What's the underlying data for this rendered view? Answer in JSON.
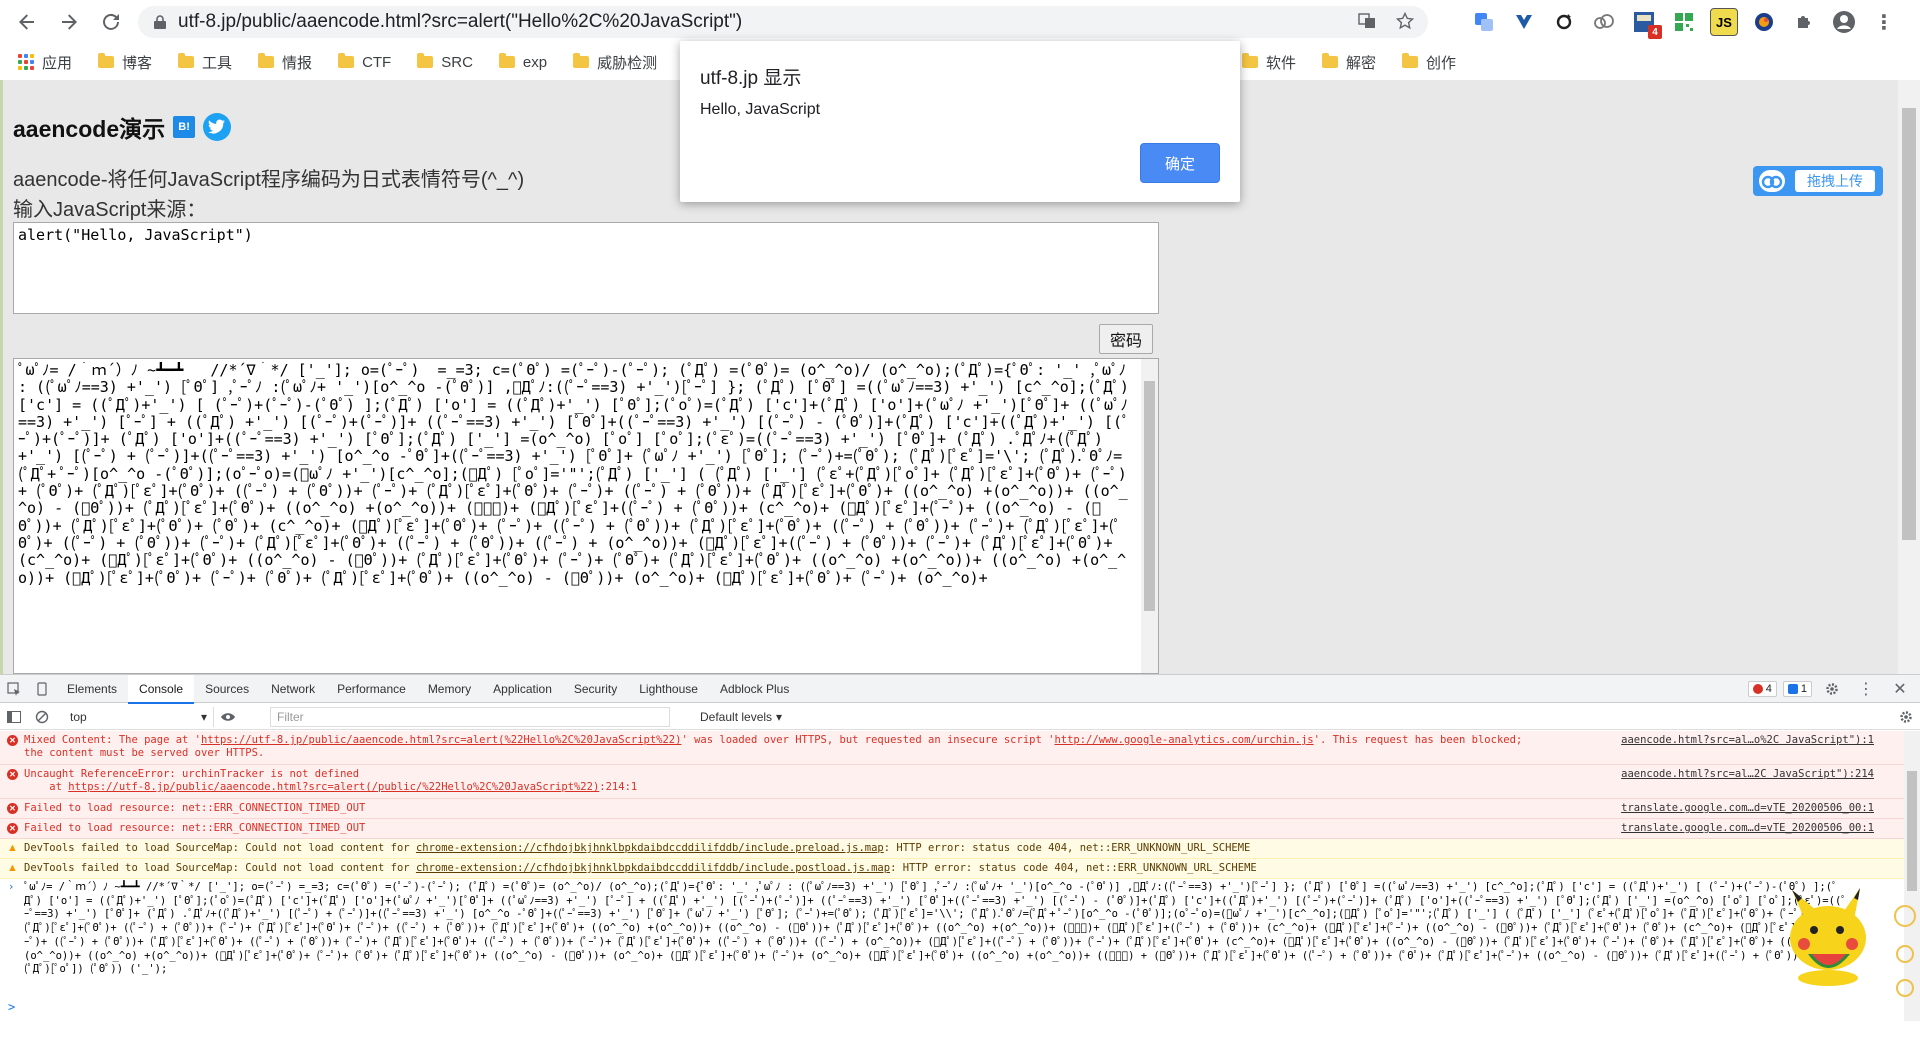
{
  "browser": {
    "url": "utf-8.jp/public/aaencode.html?src=alert(\"Hello%2C%20JavaScript\")",
    "bookmarks": [
      "应用",
      "博客",
      "工具",
      "情报",
      "CTF",
      "SRC",
      "exp",
      "威胁检测",
      "软件",
      "解密",
      "创作"
    ],
    "ext_badge": "4"
  },
  "page": {
    "title": "aaencode演示",
    "hatena_label": "B!",
    "description": "aaencode-将任何JavaScript程序编码为日式表情符号(^_^)",
    "input_label": "输入JavaScript来源：",
    "source_value": "alert(\"Hello, JavaScript\")",
    "encode_button": "密码",
    "upload_button": "拖拽上传",
    "output_text": "ﾟωﾟﾉ= /｀ｍ´）ﾉ ~┻━┻   //*´∇｀*/ ['_']; o=(ﾟｰﾟ)  =_=3; c=(ﾟΘﾟ) =(ﾟｰﾟ)-(ﾟｰﾟ); (ﾟДﾟ) =(ﾟΘﾟ)= (o^_^o)/ (o^_^o);(ﾟДﾟ)={ﾟΘﾟ: '_' ,ﾟωﾟﾉ : ((ﾟωﾟﾉ==3) +'_') [ﾟΘﾟ] ,ﾟｰﾟﾉ :(ﾟωﾟﾉ+ '_')[o^_^o -(ﾟΘﾟ)] ,ﾟДﾟﾉ:((ﾟｰﾟ==3) +'_')[ﾟｰﾟ] }; (ﾟДﾟ) [ﾟΘﾟ] =((ﾟωﾟﾉ==3) +'_') [c^_^o];(ﾟДﾟ) ['c'] = ((ﾟДﾟ)+'_') [ (ﾟｰﾟ)+(ﾟｰﾟ)-(ﾟΘﾟ) ];(ﾟДﾟ) ['o'] = ((ﾟДﾟ)+'_') [ﾟΘﾟ];(ﾟoﾟ)=(ﾟДﾟ) ['c']+(ﾟДﾟ) ['o']+(ﾟωﾟﾉ +'_')[ﾟΘﾟ]+ ((ﾟωﾟﾉ==3) +'_') [ﾟｰﾟ] + ((ﾟДﾟ) +'_') [(ﾟｰﾟ)+(ﾟｰﾟ)]+ ((ﾟｰﾟ==3) +'_') [ﾟΘﾟ]+((ﾟｰﾟ==3) +'_') [(ﾟｰﾟ) - (ﾟΘﾟ)]+(ﾟДﾟ) ['c']+((ﾟДﾟ)+'_') [(ﾟｰﾟ)+(ﾟｰﾟ)]+ (ﾟДﾟ) ['o']+((ﾟｰﾟ==3) +'_') [ﾟΘﾟ];(ﾟДﾟ) ['_'] =(o^_^o) [ﾟoﾟ] [ﾟoﾟ];(ﾟεﾟ)=((ﾟｰﾟ==3) +'_') [ﾟΘﾟ]+ (ﾟДﾟ) .ﾟДﾟﾉ+((ﾟДﾟ)+'_') [(ﾟｰﾟ) + (ﾟｰﾟ)]+((ﾟｰﾟ==3) +'_') [o^_^o -ﾟΘﾟ]+((ﾟｰﾟ==3) +'_') [ﾟΘﾟ]+ (ﾟωﾟﾉ +'_') [ﾟΘﾟ]; (ﾟｰﾟ)+=(ﾟΘﾟ); (ﾟДﾟ)[ﾟεﾟ]='\\'; (ﾟДﾟ).ﾟΘﾟﾉ=(ﾟДﾟ+ ﾟｰﾟ)[o^_^o -(ﾟΘﾟ)];(oﾟｰﾟo)=(ﾟωﾟﾉ +'_')[c^_^o];(ﾟДﾟ) [ﾟoﾟ]='\"';(ﾟДﾟ) ['_'] ( (ﾟДﾟ) ['_'] (ﾟεﾟ+(ﾟДﾟ)[ﾟoﾟ]+ (ﾟДﾟ)[ﾟεﾟ]+(ﾟΘﾟ)+ (ﾟｰﾟ)+ (ﾟΘﾟ)+ (ﾟДﾟ)[ﾟεﾟ]+(ﾟΘﾟ)+ ((ﾟｰﾟ) + (ﾟΘﾟ))+ (ﾟｰﾟ)+ (ﾟДﾟ)[ﾟεﾟ]+(ﾟΘﾟ)+ (ﾟｰﾟ)+ ((ﾟｰﾟ) + (ﾟΘﾟ))+ (ﾟДﾟ)[ﾟεﾟ]+(ﾟΘﾟ)+ ((o^_^o) +(o^_^o))+ ((o^_^o) - (ﾟΘﾟ))+ (ﾟДﾟ)[ﾟεﾟ]+(ﾟΘﾟ)+ ((o^_^o) +(o^_^o))+ (ﾟｰﾟ)+ (ﾟДﾟ)[ﾟεﾟ]+((ﾟｰﾟ) + (ﾟΘﾟ))+ (c^_^o)+ (ﾟДﾟ)[ﾟεﾟ]+(ﾟｰﾟ)+ ((o^_^o) - (ﾟΘﾟ))+ (ﾟДﾟ)[ﾟεﾟ]+(ﾟΘﾟ)+ (ﾟΘﾟ)+ (c^_^o)+ (ﾟДﾟ)[ﾟεﾟ]+(ﾟΘﾟ)+ (ﾟｰﾟ)+ ((ﾟｰﾟ) + (ﾟΘﾟ))+ (ﾟДﾟ)[ﾟεﾟ]+(ﾟΘﾟ)+ ((ﾟｰﾟ) + (ﾟΘﾟ))+ (ﾟｰﾟ)+ (ﾟДﾟ)[ﾟεﾟ]+(ﾟΘﾟ)+ ((ﾟｰﾟ) + (ﾟΘﾟ))+ (ﾟｰﾟ)+ (ﾟДﾟ)[ﾟεﾟ]+(ﾟΘﾟ)+ ((ﾟｰﾟ) + (ﾟΘﾟ))+ ((ﾟｰﾟ) + (o^_^o))+ (ﾟДﾟ)[ﾟεﾟ]+((ﾟｰﾟ) + (ﾟΘﾟ))+ (ﾟｰﾟ)+ (ﾟДﾟ)[ﾟεﾟ]+(ﾟΘﾟ)+ (c^_^o)+ (ﾟДﾟ)[ﾟεﾟ]+(ﾟΘﾟ)+ ((o^_^o) - (ﾟΘﾟ))+ (ﾟДﾟ)[ﾟεﾟ]+(ﾟΘﾟ)+ (ﾟｰﾟ)+ (ﾟΘﾟ)+ (ﾟДﾟ)[ﾟεﾟ]+(ﾟΘﾟ)+ ((o^_^o) +(o^_^o))+ ((o^_^o) +(o^_^o))+ (ﾟДﾟ)[ﾟεﾟ]+(ﾟΘﾟ)+ (ﾟｰﾟ)+ (ﾟΘﾟ)+ (ﾟДﾟ)[ﾟεﾟ]+(ﾟΘﾟ)+ ((o^_^o) - (ﾟΘﾟ))+ (o^_^o)+ (ﾟДﾟ)[ﾟεﾟ]+(ﾟΘﾟ)+ (ﾟｰﾟ)+ (o^_^o)+"
  },
  "dialog": {
    "title": "utf-8.jp 显示",
    "message": "Hello, JavaScript",
    "ok_button": "确定"
  },
  "devtools": {
    "tabs": [
      "Elements",
      "Console",
      "Sources",
      "Network",
      "Performance",
      "Memory",
      "Application",
      "Security",
      "Lighthouse",
      "Adblock Plus"
    ],
    "active_tab": "Console",
    "error_count": "4",
    "info_count": "1",
    "context": "top",
    "filter_placeholder": "Filter",
    "levels": "Default levels",
    "messages": [
      {
        "type": "error",
        "text_a": "Mixed Content: The page at '",
        "link_a": "https://utf-8.jp/public/aaencode.html?src=alert(%22Hello%2C%20JavaScript%22)",
        "text_b": "' was loaded over HTTPS, but requested an insecure script '",
        "link_b": "http://www.google-analytics.com/urchin.js",
        "text_c": "'. This request has been blocked;",
        "line2": "the content must be served over HTTPS.",
        "source": "aaencode.html?src=al…o%2C JavaScript\"):1"
      },
      {
        "type": "error",
        "text_a": "Uncaught ReferenceError: urchinTracker is not defined",
        "line2_pre": "    at ",
        "line2_link": "https://utf-8.jp/public/aaencode.html?src=alert(/public/%22Hello%2C%20JavaScript%22)",
        "line2_post": ":214:1",
        "source": "aaencode.html?src=al…2C JavaScript\"):214"
      },
      {
        "type": "error",
        "text_a": "Failed to load resource: net::ERR_CONNECTION_TIMED_OUT",
        "source": "translate.google.com…d=vTE_20200506_00:1"
      },
      {
        "type": "error",
        "text_a": "Failed to load resource: net::ERR_CONNECTION_TIMED_OUT",
        "source": "translate.google.com…d=vTE_20200506_00:1"
      },
      {
        "type": "warn",
        "text_a": "DevTools failed to load SourceMap: Could not load content for ",
        "link_a": "chrome-extension://cfhdojbkjhnklbpkdaibdccddilifddb/include.preload.js.map",
        "text_b": ": HTTP error: status code 404, net::ERR_UNKNOWN_URL_SCHEME"
      },
      {
        "type": "warn",
        "text_a": "DevTools failed to load SourceMap: Could not load content for ",
        "link_a": "chrome-extension://cfhdojbkjhnklbpkdaibdccddilifddb/include.postload.js.map",
        "text_b": ": HTTP error: status code 404, net::ERR_UNKNOWN_URL_SCHEME"
      }
    ],
    "command_echo": "ﾟωﾟﾉ= /｀ｍ´）ﾉ ~┻━┻   //*´∇｀*/ ['_']; o=(ﾟｰﾟ)  =_=3; c=(ﾟΘﾟ) =(ﾟｰﾟ)-(ﾟｰﾟ); (ﾟДﾟ) =(ﾟΘﾟ)= (o^_^o)/ (o^_^o);(ﾟДﾟ)={ﾟΘﾟ: '_' ,ﾟωﾟﾉ : ((ﾟωﾟﾉ==3) +'_') [ﾟΘﾟ] ,ﾟｰﾟﾉ :(ﾟωﾟﾉ+ '_')[o^_^o -(ﾟΘﾟ)] ,ﾟДﾟﾉ:((ﾟｰﾟ==3) +'_')[ﾟｰﾟ] }; (ﾟДﾟ) [ﾟΘﾟ] =((ﾟωﾟﾉ==3) +'_') [c^_^o];(ﾟДﾟ) ['c'] = ((ﾟДﾟ)+'_') [ (ﾟｰﾟ)+(ﾟｰﾟ)-(ﾟΘﾟ) ];(ﾟДﾟ) ['o'] = ((ﾟДﾟ)+'_') [ﾟΘﾟ];(ﾟoﾟ)=(ﾟДﾟ) ['c']+(ﾟДﾟ) ['o']+(ﾟωﾟﾉ +'_')[ﾟΘﾟ]+ ((ﾟωﾟﾉ==3) +'_') [ﾟｰﾟ] + ((ﾟДﾟ) +'_') [(ﾟｰﾟ)+(ﾟｰﾟ)]+ ((ﾟｰﾟ==3) +'_') [ﾟΘﾟ]+((ﾟｰﾟ==3) +'_') [(ﾟｰﾟ) - (ﾟΘﾟ)]+(ﾟДﾟ) ['c']+((ﾟДﾟ)+'_') [(ﾟｰﾟ)+(ﾟｰﾟ)]+ (ﾟДﾟ) ['o']+((ﾟｰﾟ==3) +'_') [ﾟΘﾟ];(ﾟДﾟ) ['_'] =(o^_^o) [ﾟoﾟ] [ﾟoﾟ];(ﾟεﾟ)=((ﾟｰﾟ==3) +'_') [ﾟΘﾟ]+ (ﾟДﾟ) .ﾟДﾟﾉ+((ﾟДﾟ)+'_') [(ﾟｰﾟ) + (ﾟｰﾟ)]+((ﾟｰﾟ==3) +'_') [o^_^o -ﾟΘﾟ]+((ﾟｰﾟ==3) +'_') [ﾟΘﾟ]+ (ﾟωﾟﾉ +'_') [ﾟΘﾟ]; (ﾟｰﾟ)+=(ﾟΘﾟ); (ﾟДﾟ)[ﾟεﾟ]='\\\\'; (ﾟДﾟ).ﾟΘﾟﾉ=(ﾟДﾟ+ ﾟｰﾟ)[o^_^o -(ﾟΘﾟ)];(oﾟｰﾟo)=(ﾟωﾟﾉ +'_')[c^_^o];(ﾟДﾟ) [ﾟoﾟ]='\"';(ﾟДﾟ) ['_'] ( (ﾟДﾟ) ['_'] (ﾟεﾟ+(ﾟДﾟ)[ﾟoﾟ]+ (ﾟДﾟ)[ﾟεﾟ]+(ﾟΘﾟ)+ (ﾟｰﾟ)+ (ﾟΘﾟ)+ (ﾟДﾟ)[ﾟεﾟ]+(ﾟΘﾟ)+ ((ﾟｰﾟ) + (ﾟΘﾟ))+ (ﾟｰﾟ)+ (ﾟДﾟ)[ﾟεﾟ]+(ﾟΘﾟ)+ (ﾟｰﾟ)+ ((ﾟｰﾟ) + (ﾟΘﾟ))+ (ﾟДﾟ)[ﾟεﾟ]+(ﾟΘﾟ)+ ((o^_^o) +(o^_^o))+ ((o^_^o) - (ﾟΘﾟ))+ (ﾟДﾟ)[ﾟεﾟ]+(ﾟΘﾟ)+ ((o^_^o) +(o^_^o))+ (ﾟｰﾟ)+ (ﾟДﾟ)[ﾟεﾟ]+((ﾟｰﾟ) + (ﾟΘﾟ))+ (c^_^o)+ (ﾟДﾟ)[ﾟεﾟ]+(ﾟｰﾟ)+ ((o^_^o) - (ﾟΘﾟ))+ (ﾟДﾟ)[ﾟεﾟ]+(ﾟΘﾟ)+ (ﾟΘﾟ)+ (c^_^o)+ (ﾟДﾟ)[ﾟεﾟ]+(ﾟΘﾟ)+ (ﾟｰﾟ)+ ((ﾟｰﾟ) + (ﾟΘﾟ))+ (ﾟДﾟ)[ﾟεﾟ]+(ﾟΘﾟ)+ ((ﾟｰﾟ) + (ﾟΘﾟ))+ (ﾟｰﾟ)+ (ﾟДﾟ)[ﾟεﾟ]+(ﾟΘﾟ)+ ((ﾟｰﾟ) + (ﾟΘﾟ))+ (ﾟｰﾟ)+ (ﾟДﾟ)[ﾟεﾟ]+(ﾟΘﾟ)+ ((ﾟｰﾟ) + (ﾟΘﾟ))+ ((ﾟｰﾟ) + (o^_^o))+ (ﾟДﾟ)[ﾟεﾟ]+((ﾟｰﾟ) + (ﾟΘﾟ))+ (ﾟｰﾟ)+ (ﾟДﾟ)[ﾟεﾟ]+(ﾟΘﾟ)+ (c^_^o)+ (ﾟДﾟ)[ﾟεﾟ]+(ﾟΘﾟ)+ ((o^_^o) - (ﾟΘﾟ))+ (ﾟДﾟ)[ﾟεﾟ]+(ﾟΘﾟ)+ (ﾟｰﾟ)+ (ﾟΘﾟ)+ (ﾟДﾟ)[ﾟεﾟ]+(ﾟΘﾟ)+ ((o^_^o) +(o^_^o))+ ((o^_^o) +(o^_^o))+ (ﾟДﾟ)[ﾟεﾟ]+(ﾟΘﾟ)+ (ﾟｰﾟ)+ (ﾟΘﾟ)+ (ﾟДﾟ)[ﾟεﾟ]+(ﾟΘﾟ)+ ((o^_^o) - (ﾟΘﾟ))+ (o^_^o)+ (ﾟДﾟ)[ﾟεﾟ]+(ﾟΘﾟ)+ (ﾟｰﾟ)+ (o^_^o)+ (ﾟДﾟ)[ﾟεﾟ]+(ﾟΘﾟ)+ ((o^_^o) +(o^_^o))+ ((ﾟｰﾟ) + (ﾟΘﾟ))+ (ﾟДﾟ)[ﾟεﾟ]+(ﾟΘﾟ)+ ((ﾟｰﾟ) + (ﾟΘﾟ))+ (ﾟΘﾟ)+ (ﾟДﾟ)[ﾟεﾟ]+(ﾟｰﾟ)+ ((o^_^o) - (ﾟΘﾟ))+ (ﾟДﾟ)[ﾟεﾟ]+((ﾟｰﾟ) + (ﾟΘﾟ))+ (ﾟΘﾟ)+ (ﾟДﾟ)[ﾟoﾟ]) (ﾟΘﾟ)) ('_');",
    "prompt": ">"
  },
  "colors": {
    "accent": "#1a73e8",
    "dialog_button": "#4a8af4",
    "error_text": "#d93025",
    "page_bg": "#e8e8e8"
  }
}
